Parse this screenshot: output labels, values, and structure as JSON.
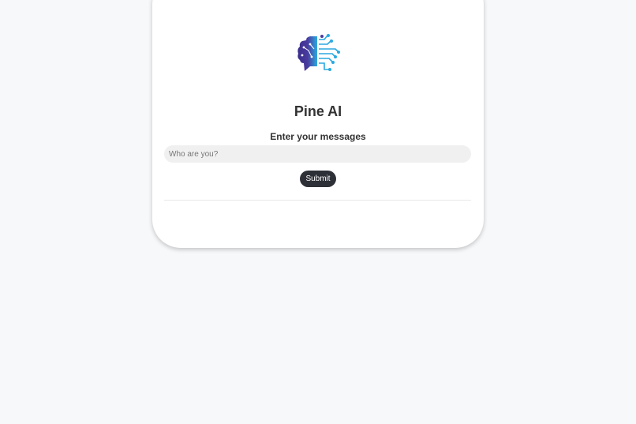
{
  "app": {
    "title": "Pine AI",
    "logo_icon": "brain-circuit-icon"
  },
  "form": {
    "prompt_label": "Enter your messages",
    "input_placeholder": "Who are you?",
    "input_value": "",
    "submit_label": "Submit"
  },
  "colors": {
    "button_bg": "#2e3038",
    "logo_left": "#3a2f8c",
    "logo_right": "#2aa9e0"
  }
}
